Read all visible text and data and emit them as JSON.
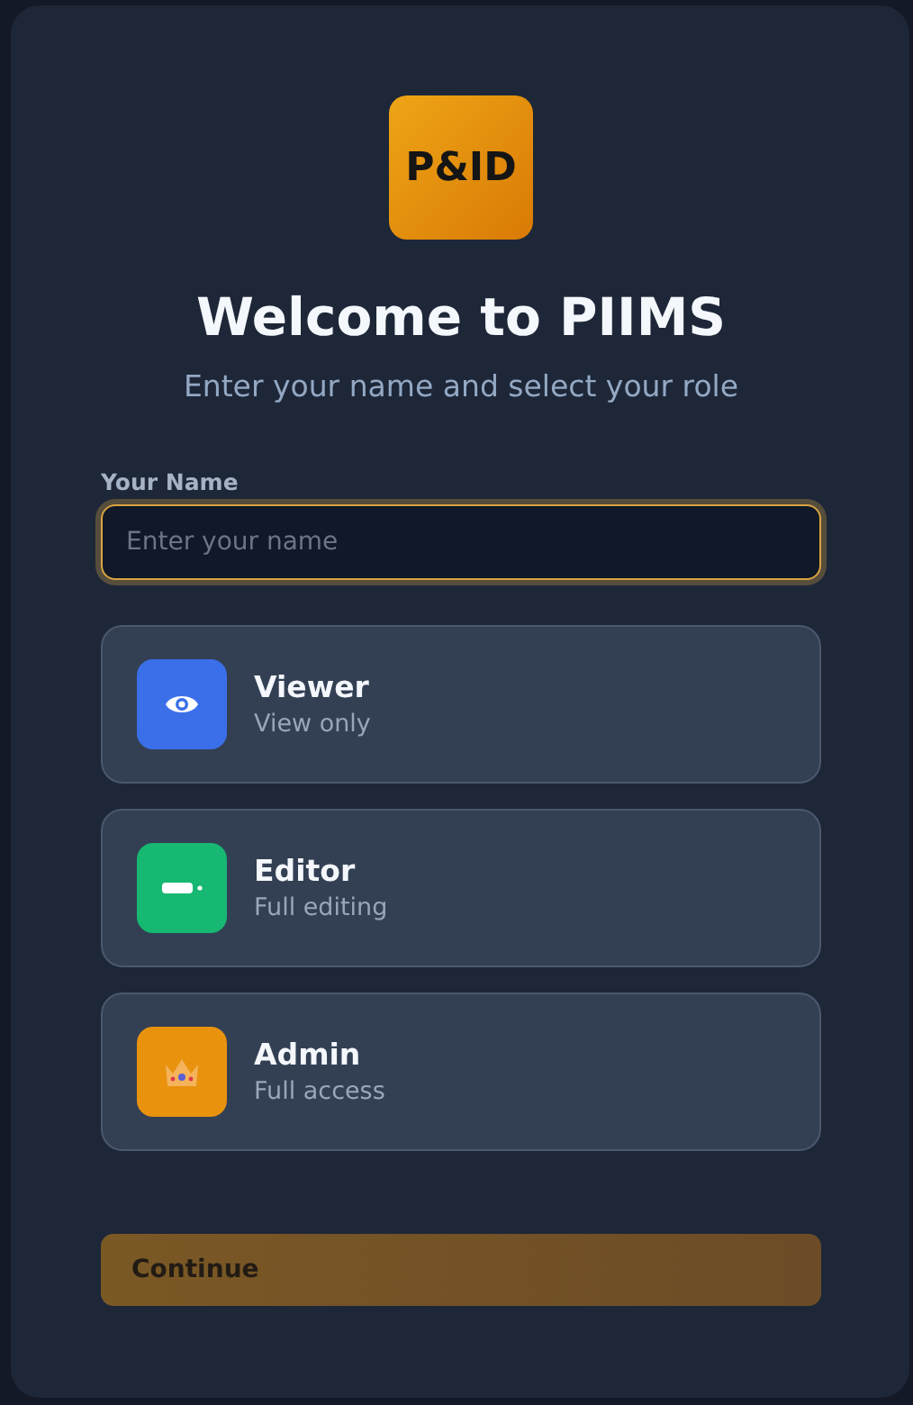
{
  "logo": {
    "text": "P&ID"
  },
  "title": "Welcome to PIIMS",
  "subtitle": "Enter your name and select your role",
  "name_field": {
    "label": "Your Name",
    "placeholder": "Enter your name",
    "focused": true
  },
  "roles": [
    {
      "kind": "eye",
      "name": "Viewer",
      "description": "View only",
      "color": "#3b6fea",
      "selected": false
    },
    {
      "kind": "pencil",
      "name": "Editor",
      "description": "Full editing",
      "color": "#17b872",
      "selected": false
    },
    {
      "kind": "crown",
      "name": "Admin",
      "description": "Full access",
      "color": "#e8920e",
      "selected": false
    }
  ],
  "continue_button": {
    "label": "Continue",
    "disabled": true
  }
}
